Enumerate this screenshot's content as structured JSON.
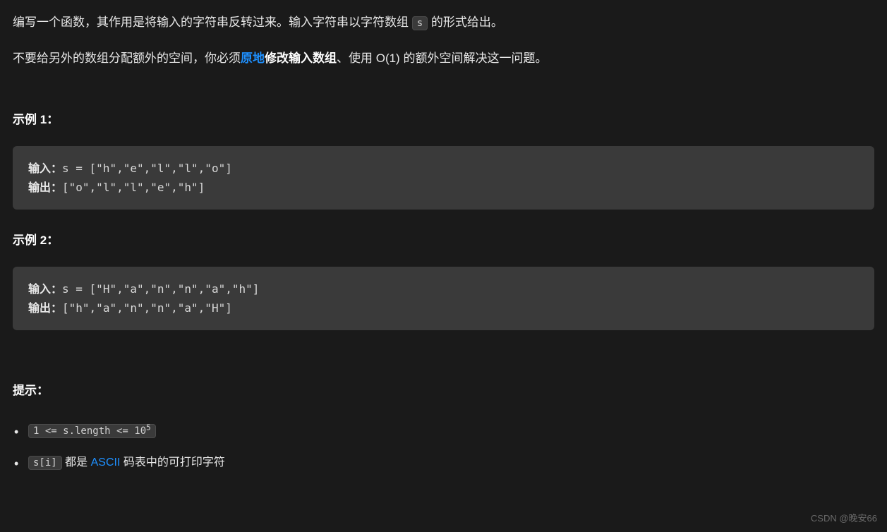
{
  "description": {
    "p1_a": "编写一个函数，其作用是将输入的字符串反转过来。输入字符串以字符数组 ",
    "p1_code": "s",
    "p1_b": " 的形式给出。",
    "p2_a": "不要给另外的数组分配额外的空间，你必须",
    "p2_link": "原地",
    "p2_bold": "修改输入数组",
    "p2_b": "、使用 O(1) 的额外空间解决这一问题。"
  },
  "example1": {
    "header": "示例 1：",
    "input_label": "输入：",
    "input_value": "s = [\"h\",\"e\",\"l\",\"l\",\"o\"]",
    "output_label": "输出：",
    "output_value": "[\"o\",\"l\",\"l\",\"e\",\"h\"]"
  },
  "example2": {
    "header": "示例 2：",
    "input_label": "输入：",
    "input_value": "s = [\"H\",\"a\",\"n\",\"n\",\"a\",\"h\"]",
    "output_label": "输出：",
    "output_value": "[\"h\",\"a\",\"n\",\"n\",\"a\",\"H\"]"
  },
  "hints": {
    "header": "提示：",
    "c1_a": "1 <= s.length <= 10",
    "c1_sup": "5",
    "c2_code": "s[i]",
    "c2_a": " 都是 ",
    "c2_link": "ASCII",
    "c2_b": " 码表中的可打印字符"
  },
  "watermark": "CSDN @晚安66"
}
